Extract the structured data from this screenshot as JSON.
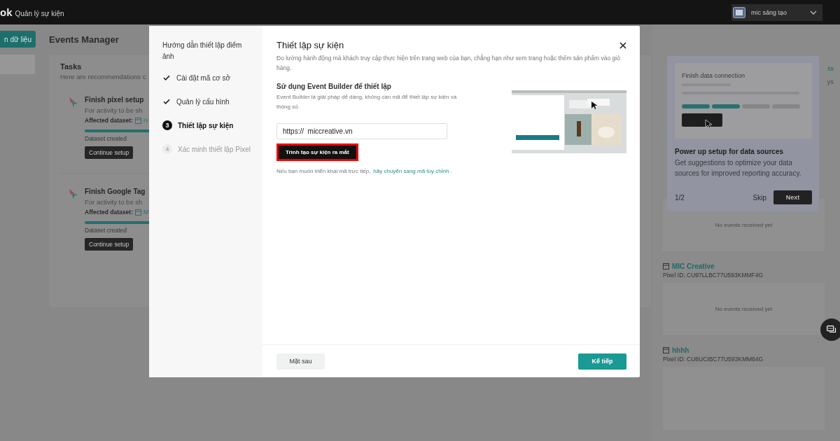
{
  "top_bar": {
    "logo": "ok",
    "title": "Quản lý sự kiện",
    "account": "mic sáng tạo"
  },
  "sidebar": {
    "button": "n dữ liệu"
  },
  "page_title": "Events Manager",
  "tasks": {
    "title": "Tasks",
    "subtitle": "Here are recommendations c",
    "items": [
      {
        "title": "Finish pixel setup",
        "text": "For activity to be sh",
        "dataset_label": "Affected dataset:",
        "dataset": "H",
        "level": 1,
        "status": "Dataset created",
        "button": "Continue setup"
      },
      {
        "title": "Finish Google Tag",
        "text": "For activity to be sh",
        "dataset_label": "Affected dataset:",
        "dataset": "M",
        "level": 1,
        "status": "Dataset created",
        "button": "Continue setup"
      }
    ]
  },
  "right_panel": {
    "cut_texts": [
      "ts",
      "ys"
    ],
    "tour": {
      "card_title": "Finish data connection",
      "title": "Power up setup for data sources",
      "text": "Get suggestions to optimize your data sources for improved reporting accuracy.",
      "counter": "1/2",
      "skip": "Skip",
      "next": "Next"
    },
    "datasets": [
      {
        "empty": "No events received yet"
      },
      {
        "name": "MIC Creative",
        "pixel_id": "Pixel ID: CU97LLBC77U593KMMF4G",
        "empty": "No events received yet"
      },
      {
        "name": "hhhh",
        "pixel_id": "Pixel ID: CU8UCIBC77U593KMM64G"
      }
    ]
  },
  "modal": {
    "guide_title": "Hướng dẫn thiết lập điểm ảnh",
    "steps": [
      {
        "label": "Cài đặt mã cơ sở",
        "done": true,
        "selected": false
      },
      {
        "label": "Quản lý cấu hình",
        "done": true,
        "selected": false
      },
      {
        "number": "3",
        "label": "Thiết lập sự kiện",
        "done": false,
        "selected": true
      },
      {
        "number": "4",
        "label": "Xác minh thiết lập Pixel",
        "done": false,
        "selected": false
      }
    ],
    "title": "Thiết lập sự kiện",
    "description": "Đo lường hành động mà khách truy cập thực hiện trên trang web của bạn, chẳng hạn như xem trang hoặc thêm sản phẩm vào giỏ hàng.",
    "section_title": "Sử dụng Event Builder để thiết lập",
    "section_text": "Event Builder là giải pháp dễ dàng, không cần mã để thiết lập sự kiện và thông số.",
    "url_value": "https://  miccreative.vn",
    "launch_button": "Trình tạo sự kiện ra mắt",
    "launch_highlighted": true,
    "note": "Nếu bạn muốn triển khai mã trực tiếp,",
    "note_link": "hãy chuyển sang mã tùy chỉnh .",
    "back_button": "Mặt sau",
    "next_button": "Kế tiếp"
  }
}
